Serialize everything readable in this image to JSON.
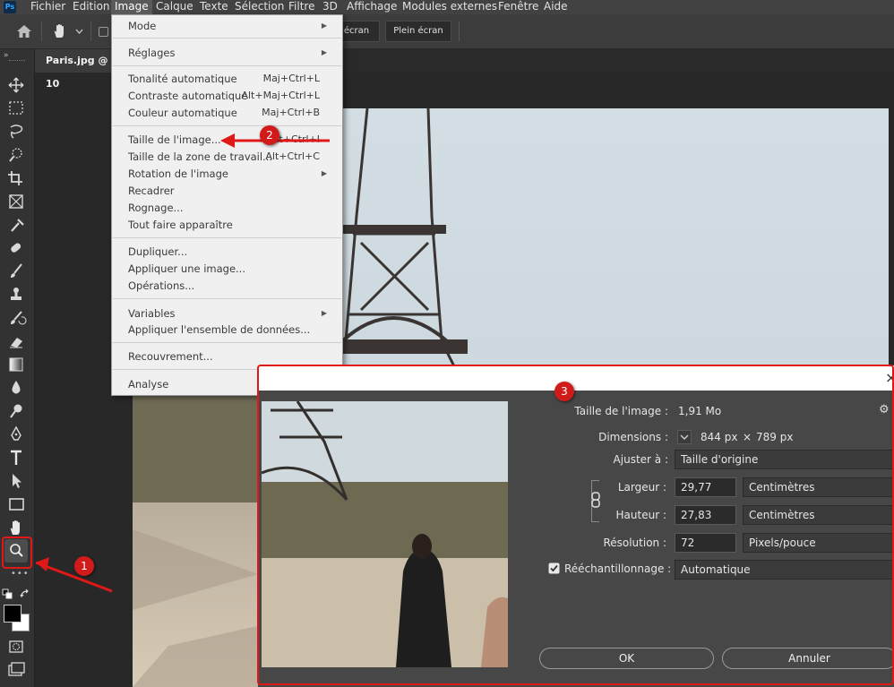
{
  "app": {
    "logo": "Ps"
  },
  "menubar": {
    "items": [
      "Fichier",
      "Edition",
      "Image",
      "Calque",
      "Texte",
      "Sélection",
      "Filtre",
      "3D",
      "Affichage",
      "Modules externes",
      "Fenêtre",
      "Aide"
    ],
    "active": "Image"
  },
  "options": {
    "btn_screen_partial": "écran",
    "btn_fullscreen": "Plein écran"
  },
  "document": {
    "tab_title": "Paris.jpg @ 10"
  },
  "image_menu": {
    "items": [
      {
        "label": "Mode",
        "shortcut": "",
        "submenu": true
      },
      {
        "label": "Réglages",
        "shortcut": "",
        "submenu": true
      },
      {
        "label": "Tonalité automatique",
        "shortcut": "Maj+Ctrl+L"
      },
      {
        "label": "Contraste automatique",
        "shortcut": "Alt+Maj+Ctrl+L"
      },
      {
        "label": "Couleur automatique",
        "shortcut": "Maj+Ctrl+B"
      },
      {
        "label": "Taille de l'image...",
        "shortcut": "Alt+Ctrl+I"
      },
      {
        "label": "Taille de la zone de travail...",
        "shortcut": "Alt+Ctrl+C"
      },
      {
        "label": "Rotation de l'image",
        "shortcut": "",
        "submenu": true
      },
      {
        "label": "Recadrer",
        "shortcut": ""
      },
      {
        "label": "Rognage...",
        "shortcut": ""
      },
      {
        "label": "Tout faire apparaître",
        "shortcut": ""
      },
      {
        "label": "Dupliquer...",
        "shortcut": ""
      },
      {
        "label": "Appliquer une image...",
        "shortcut": ""
      },
      {
        "label": "Opérations...",
        "shortcut": ""
      },
      {
        "label": "Variables",
        "shortcut": "",
        "submenu": true
      },
      {
        "label": "Appliquer l'ensemble de données...",
        "shortcut": ""
      },
      {
        "label": "Recouvrement...",
        "shortcut": ""
      },
      {
        "label": "Analyse",
        "shortcut": "",
        "submenu": true
      }
    ]
  },
  "dialog": {
    "close_glyph": "×",
    "size_label": "Taille de l'image :",
    "size_value": "1,91 Mo",
    "dimensions_label": "Dimensions :",
    "dim_width": "844 px",
    "dim_times": "×",
    "dim_height": "789 px",
    "fit_label": "Ajuster à :",
    "fit_value": "Taille d'origine",
    "width_label": "Largeur :",
    "width_value": "29,77",
    "width_unit": "Centimètres",
    "height_label": "Hauteur :",
    "height_value": "27,83",
    "height_unit": "Centimètres",
    "resolution_label": "Résolution :",
    "resolution_value": "72",
    "resolution_unit": "Pixels/pouce",
    "resample_label": "Rééchantillonnage :",
    "resample_checked": true,
    "resample_value": "Automatique",
    "ok_label": "OK",
    "cancel_label": "Annuler"
  },
  "annotations": {
    "badge1": "1",
    "badge2": "2",
    "badge3": "3"
  },
  "colors": {
    "accent_red": "#d11b1b",
    "menubar": "#424242",
    "dialog_bg": "#474747"
  }
}
